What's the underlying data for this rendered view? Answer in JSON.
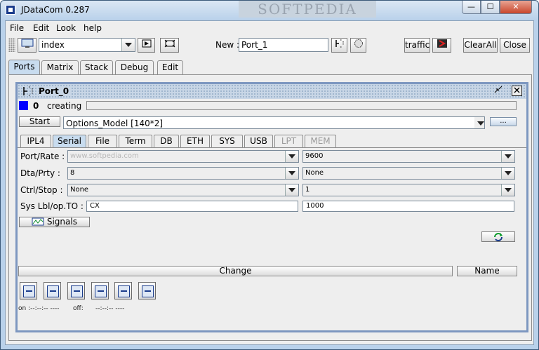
{
  "window": {
    "title": "JDataCom 0.287",
    "watermark": "SOFTPEDIA",
    "min_glyph": "—",
    "max_glyph": "☐",
    "close_glyph": "✕"
  },
  "menu": [
    "File",
    "Edit",
    "Look",
    "help"
  ],
  "toolbar": {
    "view_select": "index",
    "new_label": "New :",
    "new_value": "Port_1",
    "traffic_label": "traffic",
    "clearall_label": "ClearAll",
    "close_label": "Close"
  },
  "main_tabs": [
    {
      "label": "Ports",
      "active": true
    },
    {
      "label": "Matrix"
    },
    {
      "label": "Stack"
    },
    {
      "label": "Debug"
    },
    {
      "label": "Edit"
    }
  ],
  "port_frame": {
    "title": "Port_0",
    "status_count": "0",
    "status_text": "creating",
    "start_label": "Start",
    "model_value": "Options_Model [140*2]",
    "dots_label": "...",
    "sub_tabs": [
      {
        "label": "IPL4"
      },
      {
        "label": "Serial",
        "active": true
      },
      {
        "label": "File"
      },
      {
        "label": "Term"
      },
      {
        "label": "DB"
      },
      {
        "label": "ETH"
      },
      {
        "label": "SYS"
      },
      {
        "label": "USB"
      },
      {
        "label": "LPT",
        "disabled": true
      },
      {
        "label": "MEM",
        "disabled": true
      }
    ],
    "rows": [
      {
        "label": "Port/Rate :",
        "left": "",
        "left_hint": "www.softpedia.com",
        "right": "9600"
      },
      {
        "label": "Dta/Prty :",
        "left": "8",
        "right": "None"
      },
      {
        "label": "Ctrl/Stop :",
        "left": "None",
        "right": "1"
      },
      {
        "label": "Sys Lbl/op.TO :",
        "left": "CX",
        "right": "1000"
      }
    ],
    "signals_label": "Signals",
    "change_label": "Change",
    "name_label": "Name",
    "footer": {
      "on": "on :--:--:-- ----",
      "off": "off:",
      "off_time": "--:--:-- ----"
    }
  },
  "colors": {
    "status_square": "#0000ff",
    "frame_border": "#7d97c0",
    "active_tab": "#c8dcef"
  }
}
